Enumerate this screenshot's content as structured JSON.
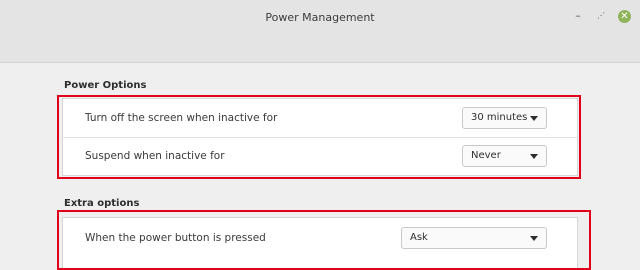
{
  "window": {
    "title": "Power Management",
    "controls": {
      "minimize": "–",
      "maximize": "⋰",
      "close": "✕"
    }
  },
  "power_options": {
    "heading": "Power Options",
    "rows": [
      {
        "label": "Turn off the screen when inactive for",
        "value": "30 minutes"
      },
      {
        "label": "Suspend when inactive for",
        "value": "Never"
      }
    ]
  },
  "extra_options": {
    "heading": "Extra options",
    "rows": [
      {
        "label": "When the power button is pressed",
        "value": "Ask"
      }
    ]
  },
  "colors": {
    "highlight": "#e0001b",
    "close_button": "#8fb35a"
  }
}
